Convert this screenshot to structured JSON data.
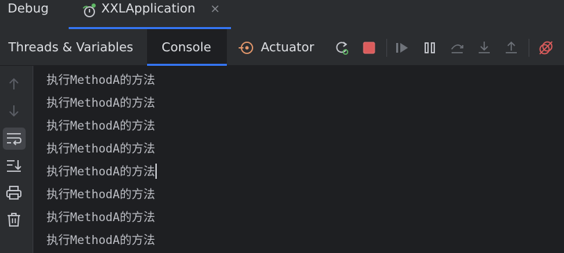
{
  "window": {
    "panel_title": "Debug",
    "run_config": "XXLApplication",
    "close_glyph": "×"
  },
  "tabs": [
    {
      "label": "Threads & Variables",
      "active": false
    },
    {
      "label": "Console",
      "active": true
    },
    {
      "label": "Actuator",
      "active": false
    }
  ],
  "toolbar": {
    "icons": [
      "rerun-icon",
      "stop-icon",
      "resume-icon",
      "pause-icon",
      "step-over-icon",
      "step-into-icon",
      "step-out-icon",
      "mute-breakpoints-icon"
    ]
  },
  "gutter": {
    "icons": [
      "up-arrow-icon",
      "down-arrow-icon",
      "soft-wrap-icon",
      "scroll-to-end-icon",
      "print-icon",
      "trash-icon"
    ]
  },
  "console": {
    "lines": [
      "执行MethodA的方法",
      "执行MethodA的方法",
      "执行MethodA的方法",
      "执行MethodA的方法",
      "执行MethodA的方法",
      "执行MethodA的方法",
      "执行MethodA的方法",
      "执行MethodA的方法"
    ],
    "caret_line": 4
  },
  "colors": {
    "accent": "#3574f0",
    "stop": "#db5c5c",
    "run_green": "#5fb865",
    "actuator_orange": "#e5986c"
  }
}
